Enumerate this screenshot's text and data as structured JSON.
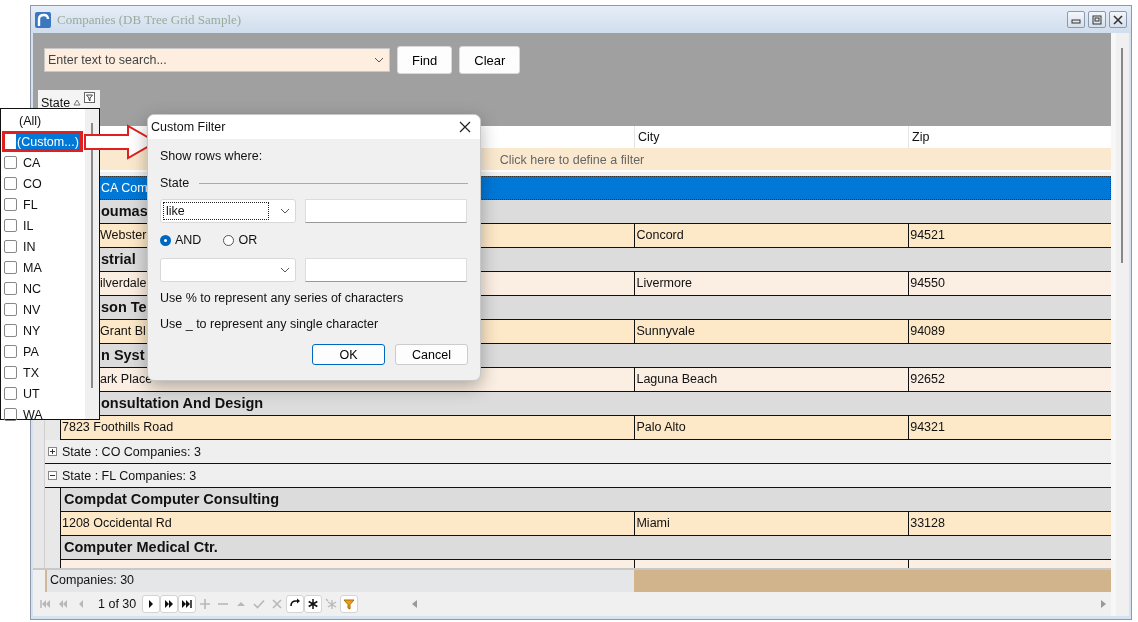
{
  "window": {
    "title": "Companies (DB Tree Grid Sample)"
  },
  "search": {
    "placeholder": "Enter text to search..."
  },
  "toolbar_buttons": [
    "Find",
    "Clear"
  ],
  "group_panel": {
    "label": "State"
  },
  "columns": [
    "City",
    "Zip"
  ],
  "filter_row": {
    "text": "Click here to define a filter"
  },
  "covered_rows": [
    {
      "kind": "group",
      "text": "CA Com",
      "selected": true
    },
    {
      "kind": "company",
      "text": "oumas",
      "selected": false
    },
    {
      "kind": "address",
      "text": "Webster",
      "city": "Concord",
      "zip": "94521",
      "selected": false
    },
    {
      "kind": "company",
      "text": "strial",
      "selected": false
    },
    {
      "kind": "address",
      "text": "ilverdale",
      "city": "Livermore",
      "zip": "94550",
      "selected": false
    },
    {
      "kind": "company",
      "text": "son Te",
      "selected": false
    },
    {
      "kind": "address",
      "text": "Grant Bl",
      "city": "Sunnyvale",
      "zip": "94089",
      "selected": false
    },
    {
      "kind": "company",
      "text": "n Syst",
      "selected": false
    },
    {
      "kind": "address",
      "text": "ark Place",
      "city": "Laguna Beach",
      "zip": "92652",
      "selected": false
    },
    {
      "kind": "company",
      "text": "onsultation And Design",
      "selected": false
    }
  ],
  "rows": [
    {
      "kind": "address",
      "text": "7823 Foothills Road",
      "city": "Palo Alto",
      "zip": "94321",
      "selected": false
    },
    {
      "kind": "group",
      "text": "State : CO Companies: 3",
      "selected": false,
      "expanded": false
    },
    {
      "kind": "group",
      "text": "State : FL Companies: 3",
      "selected": false,
      "expanded": true
    },
    {
      "kind": "company",
      "text": "Compdat Computer Consulting",
      "selected": false
    },
    {
      "kind": "address",
      "text": "1208 Occidental Rd",
      "city": "Miami",
      "zip": "33128",
      "selected": false
    },
    {
      "kind": "company",
      "text": "Computer Medical Ctr.",
      "selected": false
    },
    {
      "kind": "address",
      "selected": false
    }
  ],
  "footer": {
    "count": "Companies: 30"
  },
  "navigator": {
    "position": "1 of 30",
    "buttons": [
      {
        "kind": "first",
        "disabled": true
      },
      {
        "kind": "prev-page",
        "disabled": true
      },
      {
        "kind": "prev",
        "disabled": true
      },
      {
        "kind": "next",
        "disabled": false
      },
      {
        "kind": "next-page",
        "disabled": false
      },
      {
        "kind": "last",
        "disabled": false
      },
      {
        "kind": "add",
        "disabled": true
      },
      {
        "kind": "delete",
        "disabled": true
      },
      {
        "kind": "edit",
        "disabled": true
      },
      {
        "kind": "post",
        "disabled": true
      },
      {
        "kind": "cancel",
        "disabled": true
      },
      {
        "kind": "refresh",
        "disabled": false
      },
      {
        "kind": "bookmark",
        "disabled": false
      },
      {
        "kind": "goto-bookmark",
        "disabled": true
      },
      {
        "kind": "filter",
        "disabled": false
      }
    ]
  },
  "filter_dropdown": {
    "items": [
      {
        "kind": "plain",
        "label": "(All)",
        "selected": false
      },
      {
        "kind": "plain",
        "label": "(Custom...)",
        "selected": true
      },
      {
        "kind": "check",
        "label": "CA",
        "checked": false,
        "selected": false
      },
      {
        "kind": "check",
        "label": "CO",
        "checked": false,
        "selected": false
      },
      {
        "kind": "check",
        "label": "FL",
        "checked": false,
        "selected": false
      },
      {
        "kind": "check",
        "label": "IL",
        "checked": false,
        "selected": false
      },
      {
        "kind": "check",
        "label": "IN",
        "checked": false,
        "selected": false
      },
      {
        "kind": "check",
        "label": "MA",
        "checked": false,
        "selected": false
      },
      {
        "kind": "check",
        "label": "NC",
        "checked": false,
        "selected": false
      },
      {
        "kind": "check",
        "label": "NV",
        "checked": false,
        "selected": false
      },
      {
        "kind": "check",
        "label": "NY",
        "checked": false,
        "selected": false
      },
      {
        "kind": "check",
        "label": "PA",
        "checked": false,
        "selected": false
      },
      {
        "kind": "check",
        "label": "TX",
        "checked": false,
        "selected": false
      },
      {
        "kind": "check",
        "label": "UT",
        "checked": false,
        "selected": false
      },
      {
        "kind": "check",
        "label": "WA",
        "checked": false,
        "selected": false
      }
    ]
  },
  "dialog": {
    "title": "Custom Filter",
    "prompt": "Show rows where:",
    "field_label": "State",
    "conditions": [
      {
        "operator": "like",
        "focused": true
      },
      {
        "focused": false
      }
    ],
    "logic": [
      {
        "label": "AND",
        "selected": true
      },
      {
        "label": "OR",
        "selected": false
      }
    ],
    "hints": [
      "Use % to represent any series of characters",
      "Use _ to represent any single character"
    ],
    "buttons": [
      {
        "label": "OK",
        "default": true
      },
      {
        "label": "Cancel",
        "default": false
      }
    ]
  }
}
